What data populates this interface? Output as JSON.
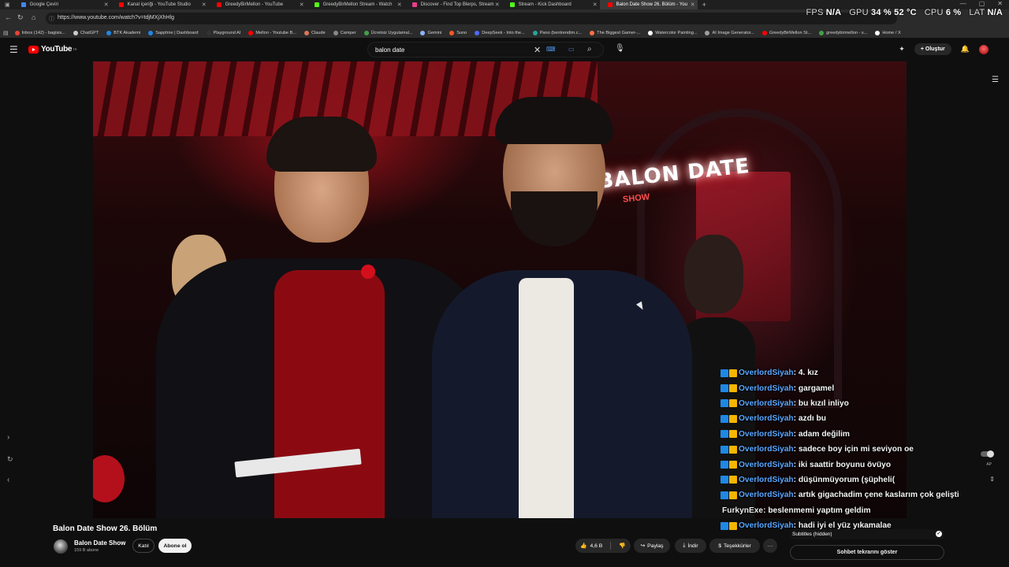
{
  "browser": {
    "tabs": [
      {
        "label": "Google Çeviri",
        "color": "#4285f4",
        "active": false
      },
      {
        "label": "Kanal içeriği - YouTube Studio",
        "color": "#ff0000",
        "active": false
      },
      {
        "label": "GreedyBirMellon - YouTube",
        "color": "#ff0000",
        "active": false
      },
      {
        "label": "GreedyBirMellon Stream - Watch",
        "color": "#53fc18",
        "active": false
      },
      {
        "label": "Discover - Find Top Blerps, Stream",
        "color": "#e83e8c",
        "active": false
      },
      {
        "label": "Stream - Kick Dashboard",
        "color": "#53fc18",
        "active": false
      },
      {
        "label": "Balon Date Show 26. Bölüm - You",
        "color": "#ff0000",
        "active": true
      }
    ],
    "url": "https://www.youtube.com/watch?v=tdjMXjXhHlg",
    "bookmarks": [
      {
        "label": "Inbox (142) - bagisis...",
        "color": "#ea4335"
      },
      {
        "label": "ChatGPT",
        "color": "#cccccc"
      },
      {
        "label": "BTK Akademi",
        "color": "#1e88e5"
      },
      {
        "label": "Sapphire | Dashboard",
        "color": "#1e88e5"
      },
      {
        "label": "Playground AI",
        "color": "#333333"
      },
      {
        "label": "Mellon - Youtube B...",
        "color": "#ff0000"
      },
      {
        "label": "Claude",
        "color": "#d97757"
      },
      {
        "label": "Camper",
        "color": "#888888"
      },
      {
        "label": "Ücretsiz Uygulamal...",
        "color": "#43a047"
      },
      {
        "label": "Gemini",
        "color": "#8ab4f8"
      },
      {
        "label": "Suno",
        "color": "#ff5722"
      },
      {
        "label": "DeepSeek - Into the...",
        "color": "#4d6bfe"
      },
      {
        "label": "Pano (bentrendim.c...",
        "color": "#26a69a"
      },
      {
        "label": "The Biggest Gamer-...",
        "color": "#ff7043"
      },
      {
        "label": "Watercolor Painting...",
        "color": "#ffffff"
      },
      {
        "label": "AI Image Generator...",
        "color": "#9e9e9e"
      },
      {
        "label": "GreedyBirMellon St...",
        "color": "#ff0000"
      },
      {
        "label": "greedybirmellon - s...",
        "color": "#43a047"
      },
      {
        "label": "Home / X",
        "color": "#ffffff"
      }
    ]
  },
  "overlay": {
    "fps_label": "FPS",
    "fps_value": "N/A",
    "gpu_label": "GPU",
    "gpu_value": "34 % 52 °C",
    "cpu_label": "CPU",
    "cpu_value": "6 %",
    "lat_label": "LAT",
    "lat_value": "N/A"
  },
  "youtube": {
    "logo_text": "YouTube",
    "logo_region": "TR",
    "search_query": "balon date",
    "create_label": "Oluştur"
  },
  "video": {
    "neon_text": "BALON DATE",
    "neon_sub": "SHOW",
    "title": "Balon Date Show 26. Bölüm",
    "channel_name": "Balon Date Show",
    "channel_subs": "159 B abone",
    "join_label": "Katıl",
    "subscribe_label": "Abone ol",
    "like_count": "4,6 B",
    "share_label": "Paylaş",
    "download_label": "İndir",
    "thanks_label": "Teşekkürler",
    "more_label": "···"
  },
  "chat": {
    "messages": [
      {
        "user": "OverlordSiyah",
        "text": ": 4. kız",
        "badges": true
      },
      {
        "user": "OverlordSiyah",
        "text": ": gargamel",
        "badges": true
      },
      {
        "user": "OverlordSiyah",
        "text": ": bu kızıl inliyo",
        "badges": true
      },
      {
        "user": "OverlordSiyah",
        "text": ": azdı bu",
        "badges": true
      },
      {
        "user": "OverlordSiyah",
        "text": ": adam değilim",
        "badges": true
      },
      {
        "user": "OverlordSiyah",
        "text": ": sadece boy için mi seviyon oe",
        "badges": true
      },
      {
        "user": "OverlordSiyah",
        "text": ": iki saattir boyunu övüyo",
        "badges": true
      },
      {
        "user": "OverlordSiyah",
        "text": ": düşünmüyorum (şüpheli(",
        "badges": true
      },
      {
        "user": "OverlordSiyah",
        "text": ": artık gigachadim çene kaslarım çok gelişti",
        "badges": true
      },
      {
        "user": "FurkynExe",
        "text": ": beslenmemi yaptım geldim",
        "badges": false
      },
      {
        "user": "OverlordSiyah",
        "text": ": hadi iyi el yüz yıkamalae",
        "badges": true
      }
    ],
    "subtitles_label": "Subtitles (hidden)",
    "show_chat_label": "Sohbet tekrarını göster",
    "autoplay_label": "AP"
  }
}
